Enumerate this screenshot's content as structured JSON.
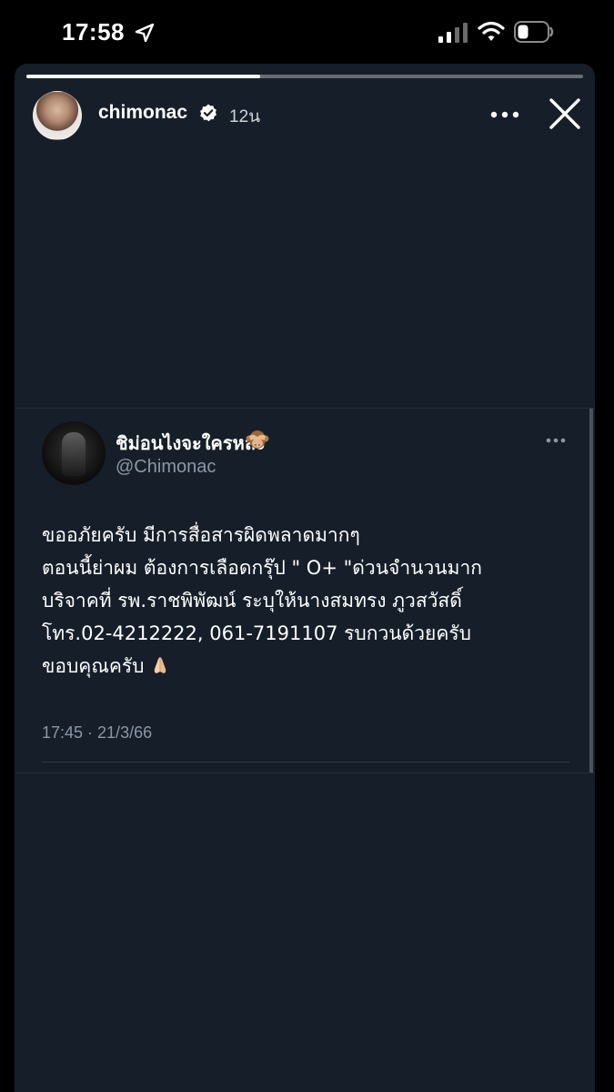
{
  "status_bar": {
    "time": "17:58",
    "location_icon": "location-arrow-icon",
    "signal_icon": "cellular-signal-icon",
    "wifi_icon": "wifi-icon",
    "battery_icon": "battery-icon"
  },
  "story": {
    "progress": 0.42,
    "username": "chimonac",
    "verified": true,
    "posted_ago": "12น",
    "more_icon": "more-horizontal-icon",
    "close_icon": "close-icon",
    "background_color": "#161e29"
  },
  "tweet": {
    "display_name": "ชิม่อนไงจะใครหล่ะ",
    "display_name_emoji": "see-no-evil-monkey-icon",
    "handle": "@Chimonac",
    "lines": [
      "ขออภัยครับ มีการสื่อสารผิดพลาดมากๆ",
      "ตอนนี้ย่าผม ต้องการเลือดกรุ๊ป \" O+ \"ด่วนจำนวนมาก",
      "บริจาคที่ รพ.ราชพิพัฒน์ ระบุให้นางสมทรง ภูวสวัสดิ์",
      "โทร.02-4212222, 061-7191107  รบกวนด้วยครับ",
      "ขอบคุณครับ"
    ],
    "closing_emoji": "folded-hands-icon",
    "timestamp": "17:45 · 21/3/66",
    "secondary_text_color": "#8b98a5"
  }
}
